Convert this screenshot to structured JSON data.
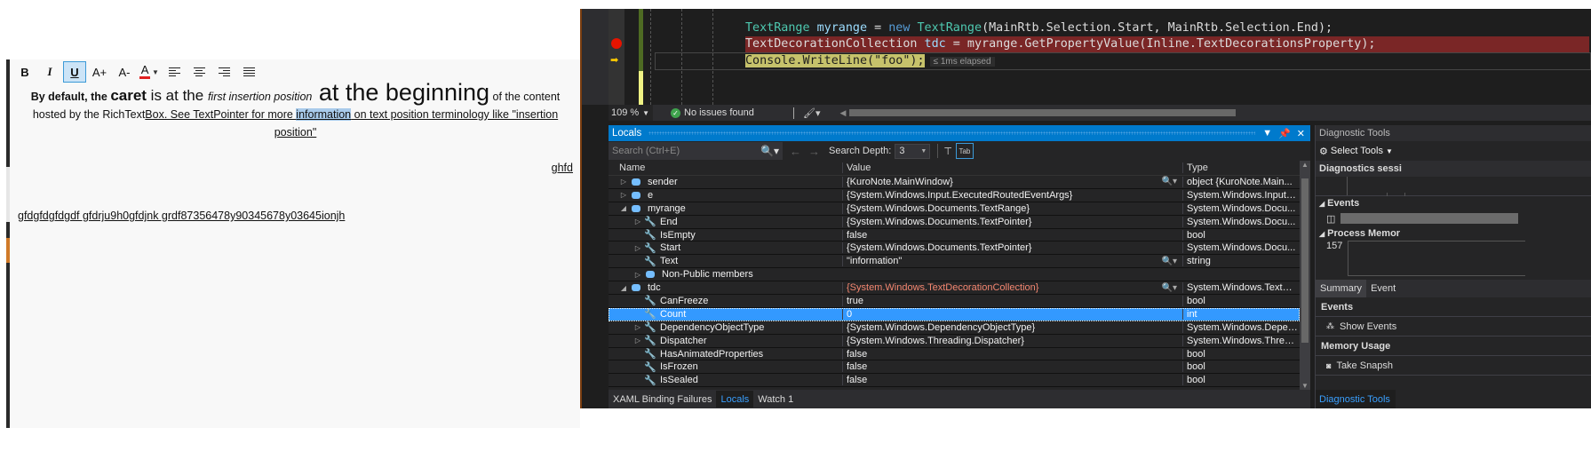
{
  "editor": {
    "toolbar": [
      {
        "name": "bold-button",
        "label": "B"
      },
      {
        "name": "italic-button",
        "label": "I"
      },
      {
        "name": "underline-button",
        "label": "U",
        "active": true
      },
      {
        "name": "increase-font-button",
        "label": "A+"
      },
      {
        "name": "decrease-font-button",
        "label": "A-"
      },
      {
        "name": "font-color-button",
        "label": "A"
      },
      {
        "name": "align-left-button",
        "label": ""
      },
      {
        "name": "align-center-button",
        "label": ""
      },
      {
        "name": "align-right-button",
        "label": ""
      },
      {
        "name": "justify-button",
        "label": ""
      }
    ],
    "font_color": "#e02020",
    "paragraph1": {
      "run1": "By default, the ",
      "run2": "caret",
      "run3": " is at the ",
      "run4": "first insertion position",
      "run5": " at the beginning",
      "run6": " of the content",
      "line2_a": "hosted by the RichText",
      "line2_b": "Box. See TextPointer for more ",
      "line2_selected": "information",
      "line2_c": " on text position terminology like \"insertion position\""
    },
    "paragraph2": "ghfd",
    "paragraph3": "gfdgfdgfdgdf gfdrju9h0gfdjnk grdf87356478y90345678y03645ionjh"
  },
  "code": {
    "line1": {
      "type": "TextRange",
      "var": " myrange",
      "op": " = ",
      "kw": "new",
      "sp": " ",
      "ctor": "TextRange",
      "args": "(MainRtb.Selection.Start, MainRtb.Selection.End);"
    },
    "line2": {
      "type": "TextDecorationCollection",
      "var": " tdc",
      "rest": " = myrange.GetPropertyValue(Inline.TextDecorationsProperty);"
    },
    "line3": {
      "code": "Console.WriteLine(\"foo\");",
      "elapsed": "≤ 1ms elapsed"
    },
    "breakpoint_color": "#e51400"
  },
  "status": {
    "zoom": "109 %",
    "issues": "No issues found"
  },
  "locals": {
    "title": "Locals",
    "search_placeholder": "Search (Ctrl+E)",
    "search_depth_label": "Search Depth:",
    "search_depth_value": "3",
    "columns": {
      "name": "Name",
      "value": "Value",
      "type": "Type"
    },
    "rows": [
      {
        "name": "sender",
        "value": "{KuroNote.MainWindow}",
        "type": "object {KuroNote.Main...",
        "indent": 0,
        "icon": "object",
        "expander": "collapsed",
        "viz": true
      },
      {
        "name": "e",
        "value": "{System.Windows.Input.ExecutedRoutedEventArgs}",
        "type": "System.Windows.Input.E...",
        "indent": 0,
        "icon": "object",
        "expander": "collapsed"
      },
      {
        "name": "myrange",
        "value": "{System.Windows.Documents.TextRange}",
        "type": "System.Windows.Docu...",
        "indent": 0,
        "icon": "object",
        "expander": "expanded"
      },
      {
        "name": "End",
        "value": "{System.Windows.Documents.TextPointer}",
        "type": "System.Windows.Docu...",
        "indent": 1,
        "icon": "property",
        "expander": "collapsed"
      },
      {
        "name": "IsEmpty",
        "value": "false",
        "type": "bool",
        "indent": 1,
        "icon": "property",
        "expander": "none"
      },
      {
        "name": "Start",
        "value": "{System.Windows.Documents.TextPointer}",
        "type": "System.Windows.Docu...",
        "indent": 1,
        "icon": "property",
        "expander": "collapsed"
      },
      {
        "name": "Text",
        "value": "\"information\"",
        "type": "string",
        "indent": 1,
        "icon": "property",
        "expander": "none",
        "viz": true
      },
      {
        "name": "Non-Public members",
        "value": "",
        "type": "",
        "indent": 1,
        "icon": "object",
        "expander": "collapsed"
      },
      {
        "name": "tdc",
        "value": "{System.Windows.TextDecorationCollection}",
        "type": "System.Windows.TextDe...",
        "indent": 0,
        "icon": "object",
        "expander": "expanded",
        "viz": true,
        "changed": true
      },
      {
        "name": "CanFreeze",
        "value": "true",
        "type": "bool",
        "indent": 1,
        "icon": "property",
        "expander": "none"
      },
      {
        "name": "Count",
        "value": "0",
        "type": "int",
        "indent": 1,
        "icon": "property",
        "expander": "none",
        "selected": true
      },
      {
        "name": "DependencyObjectType",
        "value": "{System.Windows.DependencyObjectType}",
        "type": "System.Windows.Depen...",
        "indent": 1,
        "icon": "property",
        "expander": "collapsed"
      },
      {
        "name": "Dispatcher",
        "value": "{System.Windows.Threading.Dispatcher}",
        "type": "System.Windows.Thread...",
        "indent": 1,
        "icon": "property",
        "expander": "collapsed"
      },
      {
        "name": "HasAnimatedProperties",
        "value": "false",
        "type": "bool",
        "indent": 1,
        "icon": "property",
        "expander": "none"
      },
      {
        "name": "IsFrozen",
        "value": "false",
        "type": "bool",
        "indent": 1,
        "icon": "property",
        "expander": "none"
      },
      {
        "name": "IsSealed",
        "value": "false",
        "type": "bool",
        "indent": 1,
        "icon": "property",
        "expander": "none"
      }
    ],
    "bottom_tabs": [
      {
        "label": "XAML Binding Failures",
        "active": false
      },
      {
        "label": "Locals",
        "active": true
      },
      {
        "label": "Watch 1",
        "active": false
      }
    ]
  },
  "diagnostics": {
    "title": "Diagnostic Tools",
    "select_tools": "Select Tools",
    "session": "Diagnostics sessi",
    "events_section": "Events",
    "process_memory_section": "Process Memor",
    "memory_value": "157",
    "tabs": [
      "Summary",
      "Event"
    ],
    "events_heading": "Events",
    "show_events": "Show Events",
    "memory_usage_heading": "Memory Usage",
    "take_snapshot": "Take Snapsh",
    "bottom_tab": "Diagnostic Tools"
  }
}
